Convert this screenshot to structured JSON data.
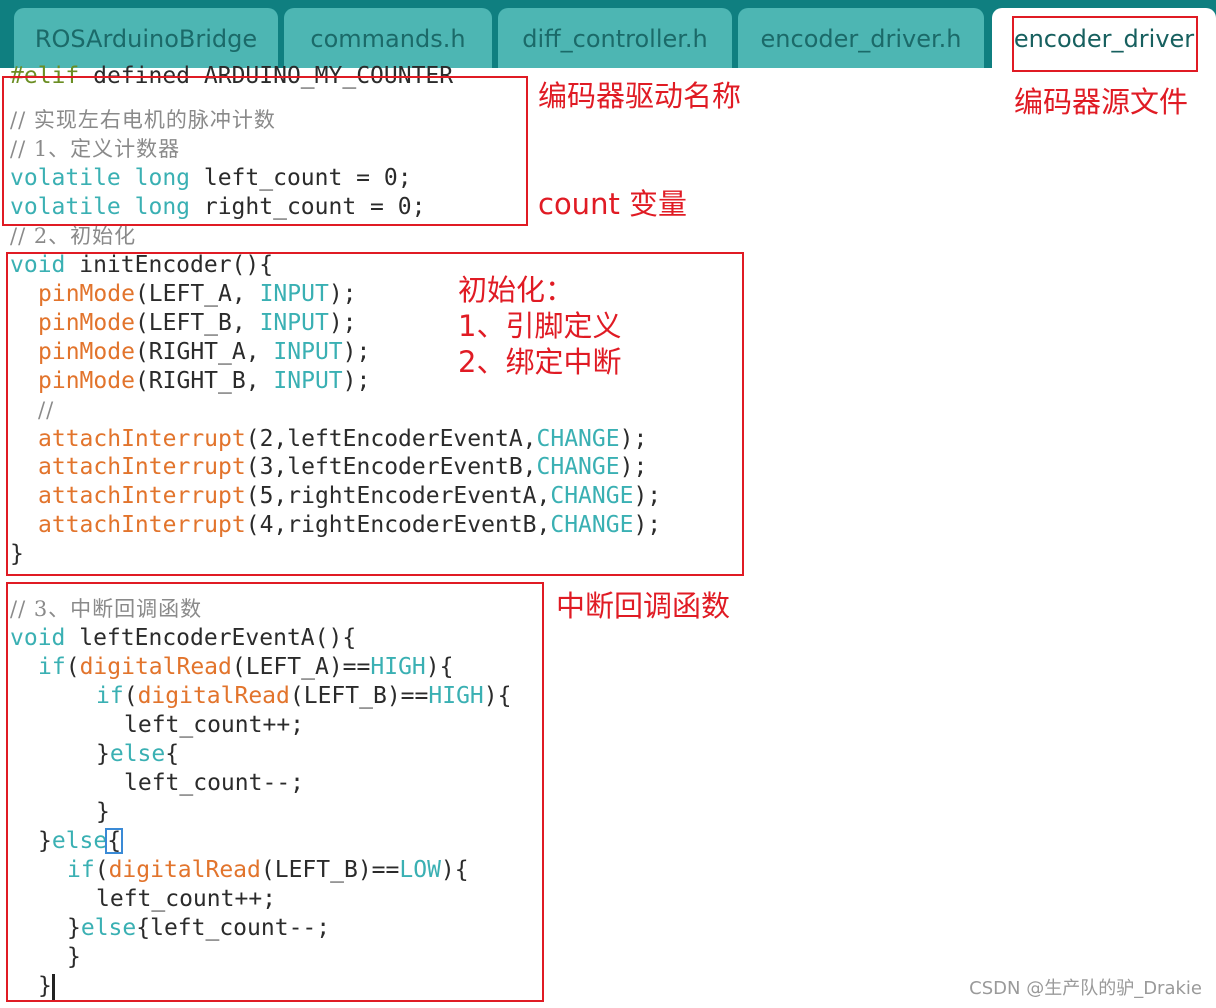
{
  "tabs": [
    {
      "label": "ROSArduinoBridge"
    },
    {
      "label": "commands.h"
    },
    {
      "label": "diff_controller.h"
    },
    {
      "label": "encoder_driver.h"
    },
    {
      "label": "encoder_driver"
    }
  ],
  "code": {
    "l1_pp": "#elif",
    "l1_rest": " defined ARDUINO_MY_COUNTER",
    "l2": "// 实现左右电机的脉冲计数",
    "l3": "// 1、定义计数器",
    "l4_kw": "volatile long",
    "l4_rest": " left_count = 0;",
    "l5_kw": "volatile long",
    "l5_rest": " right_count = 0;",
    "l6": "// 2、初始化",
    "l7_kw": "void",
    "l7_rest": " initEncoder(){",
    "l8_fn": "pinMode",
    "l8_a": "(LEFT_A, ",
    "l8_kw": "INPUT",
    "l8_b": ");",
    "l9_fn": "pinMode",
    "l9_a": "(LEFT_B, ",
    "l9_kw": "INPUT",
    "l9_b": ");",
    "l10_fn": "pinMode",
    "l10_a": "(RIGHT_A, ",
    "l10_kw": "INPUT",
    "l10_b": ");",
    "l11_fn": "pinMode",
    "l11_a": "(RIGHT_B, ",
    "l11_kw": "INPUT",
    "l11_b": ");",
    "l12": "//",
    "l13_fn": "attachInterrupt",
    "l13_a": "(2,leftEncoderEventA,",
    "l13_kw": "CHANGE",
    "l13_b": ");",
    "l14_fn": "attachInterrupt",
    "l14_a": "(3,leftEncoderEventB,",
    "l14_kw": "CHANGE",
    "l14_b": ");",
    "l15_fn": "attachInterrupt",
    "l15_a": "(5,rightEncoderEventA,",
    "l15_kw": "CHANGE",
    "l15_b": ");",
    "l16_fn": "attachInterrupt",
    "l16_a": "(4,rightEncoderEventB,",
    "l16_kw": "CHANGE",
    "l16_b": ");",
    "l17": "}",
    "l18": "// 3、中断回调函数",
    "l19_kw": "void",
    "l19_rest": " leftEncoderEventA(){",
    "l20_kw": "if",
    "l20_a": "(",
    "l20_fn": "digitalRead",
    "l20_b": "(LEFT_A)==",
    "l20_kw2": "HIGH",
    "l20_c": "){",
    "l21_kw": "if",
    "l21_a": "(",
    "l21_fn": "digitalRead",
    "l21_b": "(LEFT_B)==",
    "l21_kw2": "HIGH",
    "l21_c": "){",
    "l22": "left_count++;",
    "l23_a": "}",
    "l23_kw": "else",
    "l23_b": "{",
    "l24": "left_count--;",
    "l25": "}",
    "l26_a": "}",
    "l26_kw": "else",
    "l26_b": "{",
    "l27_kw": "if",
    "l27_a": "(",
    "l27_fn": "digitalRead",
    "l27_b": "(LEFT_B)==",
    "l27_kw2": "LOW",
    "l27_c": "){",
    "l28": "left_count++;",
    "l29_a": "}",
    "l29_kw": "else",
    "l29_b": "{left_count--;",
    "l30": "}",
    "l31": "}"
  },
  "annotations": {
    "encoder_name": "编码器驱动名称",
    "source_file": "编码器源文件",
    "count_vars": "count 变量",
    "init_title": "初始化：",
    "init_1": "1、引脚定义",
    "init_2": "2、绑定中断",
    "callbacks": "中断回调函数"
  },
  "watermark": "CSDN @生产队的驴_Drakie",
  "colors": {
    "tab_bar": "#0f7f80",
    "tab": "#4db6b3",
    "keyword": "#3ab0b3",
    "function": "#e2742c",
    "annotation_red": "#e01b24"
  }
}
